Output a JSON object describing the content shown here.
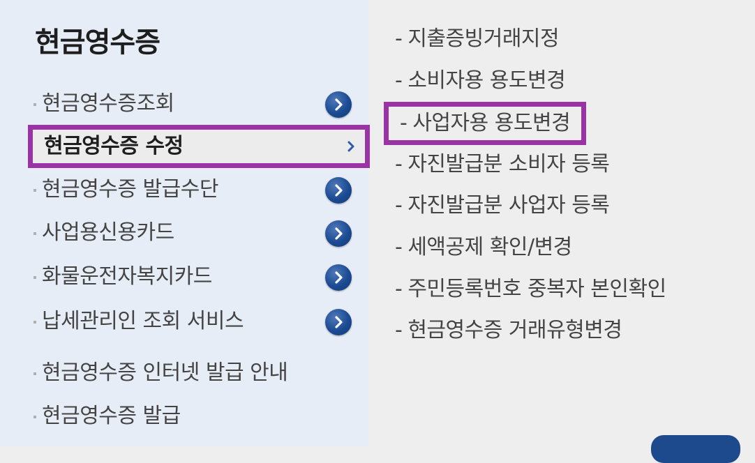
{
  "left_menu": {
    "title": "현금영수증",
    "items": [
      {
        "label": "현금영수증조회",
        "has_arrow": true
      },
      {
        "label": "현금영수증 수정",
        "active": true
      },
      {
        "label": "현금영수증 발급수단",
        "has_arrow": true
      },
      {
        "label": "사업용신용카드",
        "has_arrow": true
      },
      {
        "label": "화물운전자복지카드",
        "has_arrow": true
      },
      {
        "label": "납세관리인 조회 서비스",
        "has_arrow": true
      },
      {
        "label": "현금영수증 인터넷 발급 안내"
      },
      {
        "label": "현금영수증 발급"
      }
    ]
  },
  "submenu": {
    "dash": "-",
    "items": [
      {
        "label": "지출증빙거래지정"
      },
      {
        "label": "소비자용 용도변경"
      },
      {
        "label": "사업자용 용도변경",
        "highlighted": true
      },
      {
        "label": "자진발급분 소비자 등록"
      },
      {
        "label": "자진발급분 사업자 등록"
      },
      {
        "label": "세액공제 확인/변경"
      },
      {
        "label": "주민등록번호 중복자 본인확인"
      },
      {
        "label": "현금영수증 거래유형변경"
      }
    ]
  },
  "colors": {
    "highlight_border": "#9a33a3",
    "arrow_button": "#1c4b93",
    "left_panel_bg": "#e6edf6",
    "right_panel_bg": "#eeeeee"
  },
  "icons": {
    "arrow_button": "chevron-right-circle-icon",
    "active_chevron": "chevron-right-icon"
  }
}
